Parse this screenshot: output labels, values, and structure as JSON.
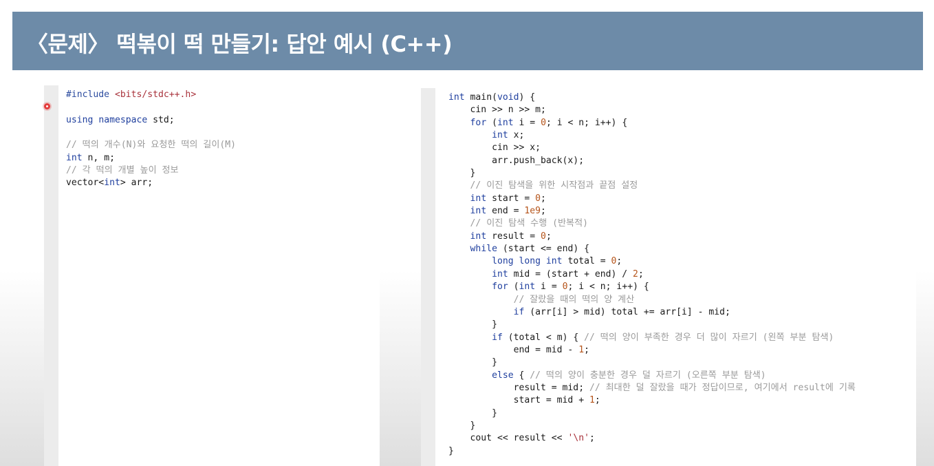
{
  "slide": {
    "title": "〈문제〉 떡볶이 떡 만들기: 답안 예시 (C++)"
  },
  "left_code": {
    "lines": [
      [
        {
          "t": "#include ",
          "c": "pp"
        },
        {
          "t": "<bits/stdc++.h>",
          "c": "hdr"
        }
      ],
      [],
      [
        {
          "t": "using",
          "c": "kw"
        },
        {
          "t": " "
        },
        {
          "t": "namespace",
          "c": "kw"
        },
        {
          "t": " std;"
        }
      ],
      [],
      [
        {
          "t": "// 떡의 개수(N)와 요청한 떡의 길이(M)",
          "c": "cm"
        }
      ],
      [
        {
          "t": "int",
          "c": "kw"
        },
        {
          "t": " n, m;"
        }
      ],
      [
        {
          "t": "// 각 떡의 개별 높이 정보",
          "c": "cm"
        }
      ],
      [
        {
          "t": "vector<"
        },
        {
          "t": "int",
          "c": "kw"
        },
        {
          "t": "> arr;"
        }
      ]
    ]
  },
  "right_code": {
    "lines": [
      [
        {
          "t": "int",
          "c": "kw"
        },
        {
          "t": " main("
        },
        {
          "t": "void",
          "c": "kw"
        },
        {
          "t": ") {"
        }
      ],
      [
        {
          "t": "    cin >> n >> m;"
        }
      ],
      [
        {
          "t": "    "
        },
        {
          "t": "for",
          "c": "kw"
        },
        {
          "t": " ("
        },
        {
          "t": "int",
          "c": "kw"
        },
        {
          "t": " i = "
        },
        {
          "t": "0",
          "c": "num"
        },
        {
          "t": "; i < n; i++) {"
        }
      ],
      [
        {
          "t": "        "
        },
        {
          "t": "int",
          "c": "kw"
        },
        {
          "t": " x;"
        }
      ],
      [
        {
          "t": "        cin >> x;"
        }
      ],
      [
        {
          "t": "        arr.push_back(x);"
        }
      ],
      [
        {
          "t": "    }"
        }
      ],
      [
        {
          "t": "    "
        },
        {
          "t": "// 이진 탐색을 위한 시작점과 끝점 설정",
          "c": "cm"
        }
      ],
      [
        {
          "t": "    "
        },
        {
          "t": "int",
          "c": "kw"
        },
        {
          "t": " start = "
        },
        {
          "t": "0",
          "c": "num"
        },
        {
          "t": ";"
        }
      ],
      [
        {
          "t": "    "
        },
        {
          "t": "int",
          "c": "kw"
        },
        {
          "t": " end = "
        },
        {
          "t": "1e9",
          "c": "num"
        },
        {
          "t": ";"
        }
      ],
      [
        {
          "t": "    "
        },
        {
          "t": "// 이진 탐색 수행 (반복적)",
          "c": "cm"
        }
      ],
      [
        {
          "t": "    "
        },
        {
          "t": "int",
          "c": "kw"
        },
        {
          "t": " result = "
        },
        {
          "t": "0",
          "c": "num"
        },
        {
          "t": ";"
        }
      ],
      [
        {
          "t": "    "
        },
        {
          "t": "while",
          "c": "kw"
        },
        {
          "t": " (start <= end) {"
        }
      ],
      [
        {
          "t": "        "
        },
        {
          "t": "long long int",
          "c": "kw"
        },
        {
          "t": " total = "
        },
        {
          "t": "0",
          "c": "num"
        },
        {
          "t": ";"
        }
      ],
      [
        {
          "t": "        "
        },
        {
          "t": "int",
          "c": "kw"
        },
        {
          "t": " mid = (start + end) / "
        },
        {
          "t": "2",
          "c": "num"
        },
        {
          "t": ";"
        }
      ],
      [
        {
          "t": "        "
        },
        {
          "t": "for",
          "c": "kw"
        },
        {
          "t": " ("
        },
        {
          "t": "int",
          "c": "kw"
        },
        {
          "t": " i = "
        },
        {
          "t": "0",
          "c": "num"
        },
        {
          "t": "; i < n; i++) {"
        }
      ],
      [
        {
          "t": "            "
        },
        {
          "t": "// 잘랐을 때의 떡의 양 계산",
          "c": "cm"
        }
      ],
      [
        {
          "t": "            "
        },
        {
          "t": "if",
          "c": "kw"
        },
        {
          "t": " (arr[i] > mid) total += arr[i] - mid;"
        }
      ],
      [
        {
          "t": "        }"
        }
      ],
      [
        {
          "t": "        "
        },
        {
          "t": "if",
          "c": "kw"
        },
        {
          "t": " (total < m) { "
        },
        {
          "t": "// 떡의 양이 부족한 경우 더 많이 자르기 (왼쪽 부분 탐색)",
          "c": "cm"
        }
      ],
      [
        {
          "t": "            end = mid - "
        },
        {
          "t": "1",
          "c": "num"
        },
        {
          "t": ";"
        }
      ],
      [
        {
          "t": "        }"
        }
      ],
      [
        {
          "t": "        "
        },
        {
          "t": "else",
          "c": "kw"
        },
        {
          "t": " { "
        },
        {
          "t": "// 떡의 양이 충분한 경우 덜 자르기 (오른쪽 부분 탐색)",
          "c": "cm"
        }
      ],
      [
        {
          "t": "            result = mid; "
        },
        {
          "t": "// 최대한 덜 잘랐을 때가 정답이므로, 여기에서 result에 기록",
          "c": "cm"
        }
      ],
      [
        {
          "t": "            start = mid + "
        },
        {
          "t": "1",
          "c": "num"
        },
        {
          "t": ";"
        }
      ],
      [
        {
          "t": "        }"
        }
      ],
      [
        {
          "t": "    }"
        }
      ],
      [
        {
          "t": "    cout << result << "
        },
        {
          "t": "'\\n'",
          "c": "str"
        },
        {
          "t": ";"
        }
      ],
      [
        {
          "t": "}"
        }
      ]
    ]
  }
}
